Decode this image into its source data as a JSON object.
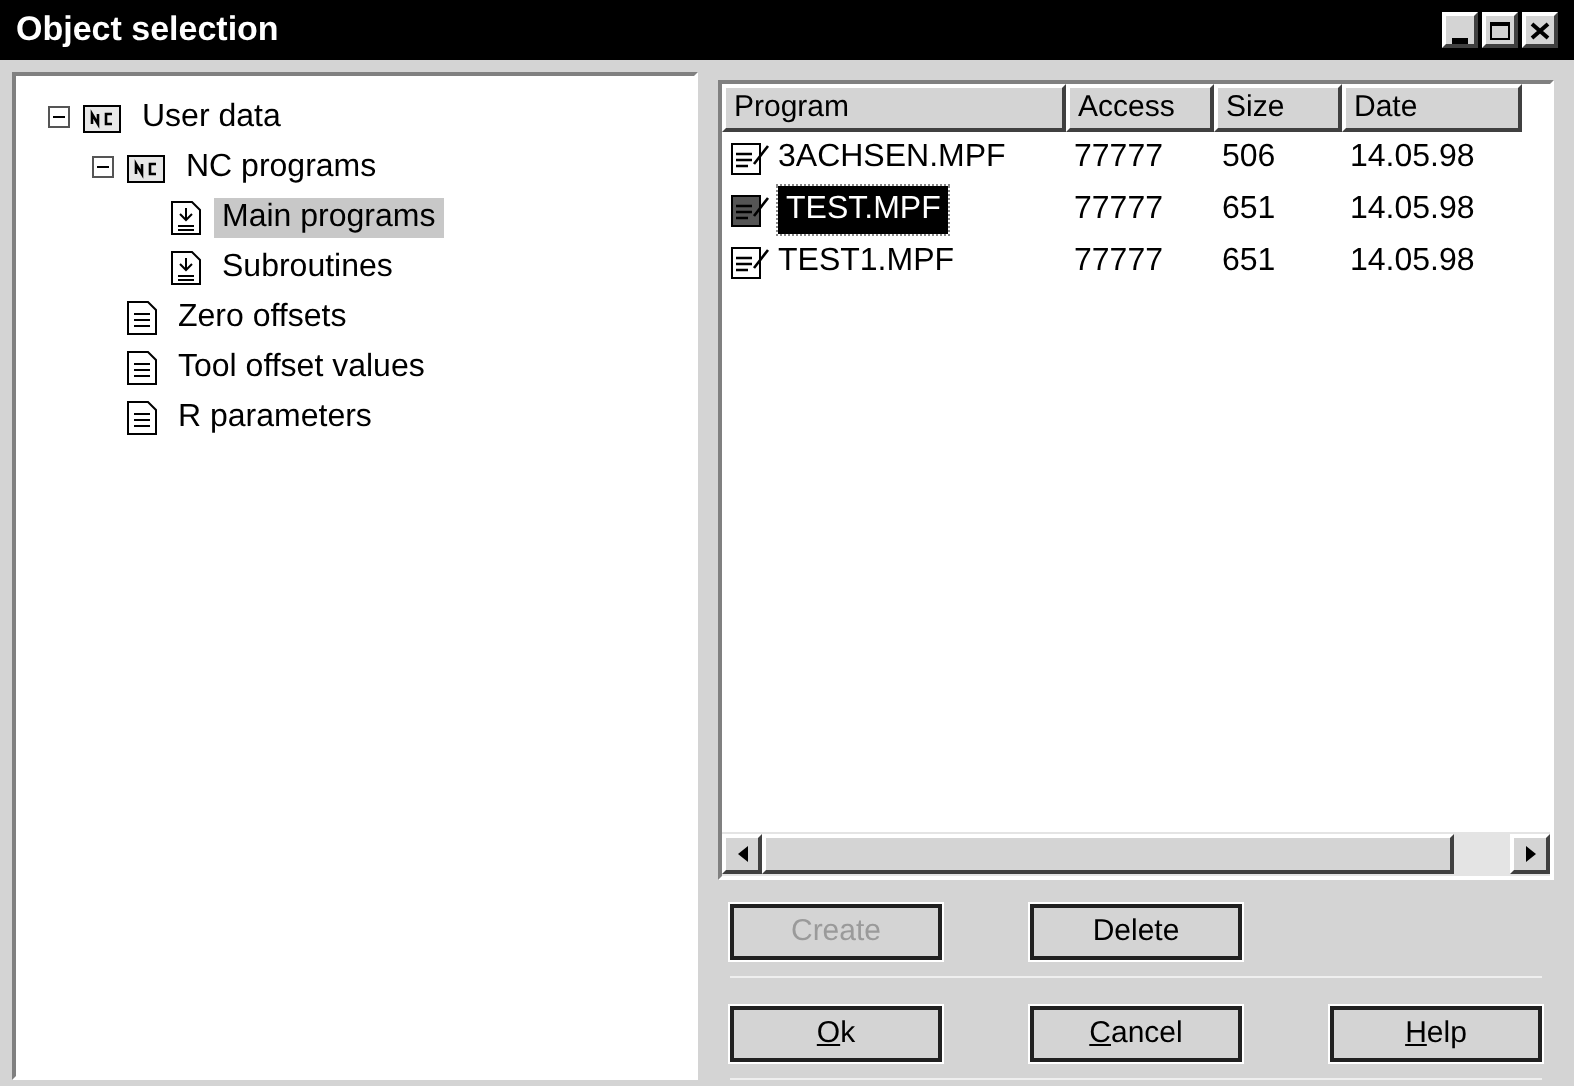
{
  "window": {
    "title": "Object selection"
  },
  "tree": [
    {
      "label": "User data",
      "kind": "nc",
      "expanded": true,
      "selected": false,
      "children": [
        {
          "label": "NC programs",
          "kind": "nc",
          "expanded": true,
          "selected": false,
          "children": [
            {
              "label": "Main programs",
              "kind": "program",
              "selected": true
            },
            {
              "label": "Subroutines",
              "kind": "program",
              "selected": false
            }
          ]
        },
        {
          "label": "Zero offsets",
          "kind": "doc",
          "selected": false
        },
        {
          "label": "Tool offset values",
          "kind": "doc",
          "selected": false
        },
        {
          "label": "R parameters",
          "kind": "doc",
          "selected": false
        }
      ]
    }
  ],
  "table": {
    "columns": [
      "Program",
      "Access",
      "Size",
      "Date"
    ],
    "rows": [
      {
        "cells": [
          "3ACHSEN.MPF",
          "77777",
          "506",
          "14.05.98"
        ],
        "selected": false
      },
      {
        "cells": [
          "TEST.MPF",
          "77777",
          "651",
          "14.05.98"
        ],
        "selected": true
      },
      {
        "cells": [
          "TEST1.MPF",
          "77777",
          "651",
          "14.05.98"
        ],
        "selected": false
      }
    ]
  },
  "buttons": [
    [
      {
        "label": "Create",
        "disabled": true,
        "underline_first": false
      },
      {
        "label": "Delete",
        "disabled": false,
        "underline_first": false
      }
    ],
    [
      {
        "label": "Ok",
        "disabled": false,
        "underline_first": true
      },
      {
        "label": "Cancel",
        "disabled": false,
        "underline_first": true
      },
      {
        "label": "Help",
        "disabled": false,
        "underline_first": true
      }
    ]
  ]
}
